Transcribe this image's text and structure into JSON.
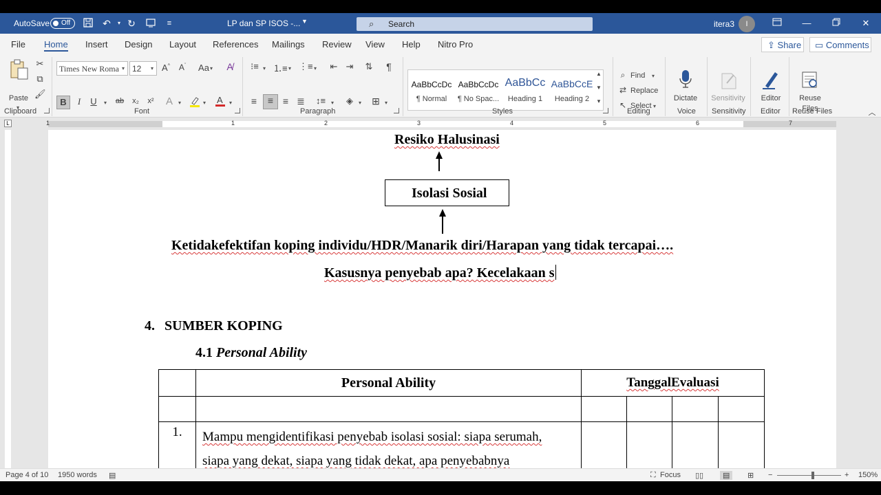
{
  "titlebar": {
    "autosave_label": "AutoSave",
    "autosave_state": "Off",
    "doc_title": "LP dan SP ISOS -...",
    "search_placeholder": "Search",
    "user_name": "itera3",
    "avatar_initial": "I",
    "brand_color": "#2b579a"
  },
  "menu": {
    "tabs": [
      "File",
      "Home",
      "Insert",
      "Design",
      "Layout",
      "References",
      "Mailings",
      "Review",
      "View",
      "Help",
      "Nitro Pro"
    ],
    "active_tab": "Home",
    "share_label": "Share",
    "comments_label": "Comments"
  },
  "ribbon": {
    "clipboard": {
      "label": "Clipboard",
      "paste_label": "Paste"
    },
    "font": {
      "label": "Font",
      "font_name": "Times New Roma",
      "font_size": "12"
    },
    "paragraph": {
      "label": "Paragraph"
    },
    "styles": {
      "label": "Styles",
      "items": [
        {
          "sample": "AaBbCcDc",
          "name": "¶ Normal"
        },
        {
          "sample": "AaBbCcDc",
          "name": "¶ No Spac..."
        },
        {
          "sample": "AaBbCc",
          "name": "Heading 1"
        },
        {
          "sample": "AaBbCcE",
          "name": "Heading 2"
        }
      ]
    },
    "editing": {
      "label": "Editing",
      "find": "Find",
      "replace": "Replace",
      "select": "Select"
    },
    "voice": {
      "label": "Voice",
      "dictate": "Dictate"
    },
    "sensitivity": {
      "label": "Sensitivity",
      "button": "Sensitivity"
    },
    "editor": {
      "label": "Editor",
      "button": "Editor"
    },
    "reuse": {
      "label": "Reuse Files",
      "button_line1": "Reuse",
      "button_line2": "Files"
    }
  },
  "ruler": {
    "numbers": [
      "1",
      "1",
      "2",
      "3",
      "4",
      "5",
      "6",
      "7"
    ]
  },
  "document": {
    "resiko": "Resiko Halusinasi",
    "isolasi": "Isolasi Sosial",
    "ketidak": "Ketidakefektifan koping individu/HDR/Manarik diri/Harapan yang tidak tercapai….",
    "kasus": "Kasusnya penyebab apa? Kecelakaan s",
    "section_number": "4.",
    "section_title": "SUMBER KOPING",
    "subsection_number": "4.1",
    "subsection_title": "Personal Ability",
    "table": {
      "header_personal": "Personal Ability",
      "header_tanggal": "TanggalEvaluasi",
      "row1_number": "1.",
      "row1_line1": "Mampu mengidentifikasi penyebab isolasi sosial: siapa serumah,",
      "row1_line2": "siapa yang dekat, siapa yang tidak dekat, apa penyebabnya"
    }
  },
  "statusbar": {
    "page": "Page 4 of 10",
    "words": "1950 words",
    "focus": "Focus",
    "zoom": "150%"
  }
}
